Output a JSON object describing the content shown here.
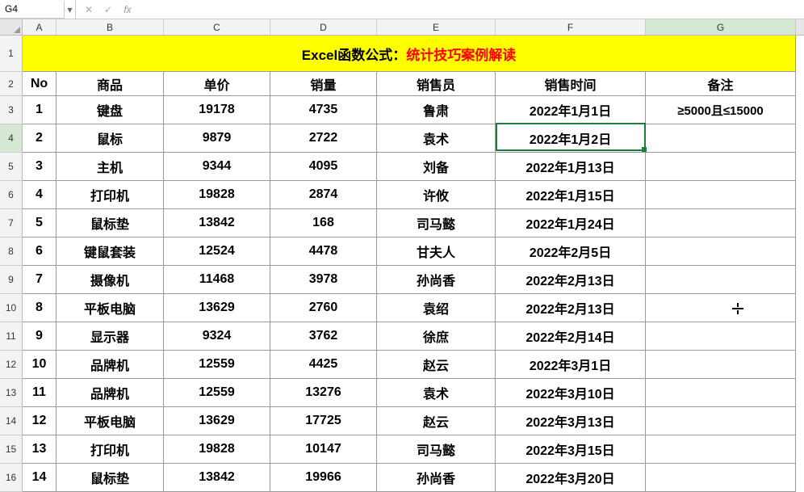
{
  "name_box": "G4",
  "formula": "",
  "col_labels": [
    "A",
    "B",
    "C",
    "D",
    "E",
    "F",
    "G"
  ],
  "selected_col": 6,
  "selected_row": 4,
  "title": {
    "black": "Excel函数公式：",
    "red": "统计技巧案例解读"
  },
  "headers": [
    "No",
    "商品",
    "单价",
    "销量",
    "销售员",
    "销售时间",
    "备注"
  ],
  "remark_first": "≥5000且≤15000",
  "rows": [
    {
      "no": "1",
      "p": "键盘",
      "price": "19178",
      "qty": "4735",
      "sales": "鲁肃",
      "date": "2022年1月1日"
    },
    {
      "no": "2",
      "p": "鼠标",
      "price": "9879",
      "qty": "2722",
      "sales": "袁术",
      "date": "2022年1月2日"
    },
    {
      "no": "3",
      "p": "主机",
      "price": "9344",
      "qty": "4095",
      "sales": "刘备",
      "date": "2022年1月13日"
    },
    {
      "no": "4",
      "p": "打印机",
      "price": "19828",
      "qty": "2874",
      "sales": "许攸",
      "date": "2022年1月15日"
    },
    {
      "no": "5",
      "p": "鼠标垫",
      "price": "13842",
      "qty": "168",
      "sales": "司马懿",
      "date": "2022年1月24日"
    },
    {
      "no": "6",
      "p": "键鼠套装",
      "price": "12524",
      "qty": "4478",
      "sales": "甘夫人",
      "date": "2022年2月5日"
    },
    {
      "no": "7",
      "p": "摄像机",
      "price": "11468",
      "qty": "3978",
      "sales": "孙尚香",
      "date": "2022年2月13日"
    },
    {
      "no": "8",
      "p": "平板电脑",
      "price": "13629",
      "qty": "2760",
      "sales": "袁绍",
      "date": "2022年2月13日"
    },
    {
      "no": "9",
      "p": "显示器",
      "price": "9324",
      "qty": "3762",
      "sales": "徐庶",
      "date": "2022年2月14日"
    },
    {
      "no": "10",
      "p": "品牌机",
      "price": "12559",
      "qty": "4425",
      "sales": "赵云",
      "date": "2022年3月1日"
    },
    {
      "no": "11",
      "p": "品牌机",
      "price": "12559",
      "qty": "13276",
      "sales": "袁术",
      "date": "2022年3月10日"
    },
    {
      "no": "12",
      "p": "平板电脑",
      "price": "13629",
      "qty": "17725",
      "sales": "赵云",
      "date": "2022年3月13日"
    },
    {
      "no": "13",
      "p": "打印机",
      "price": "19828",
      "qty": "10147",
      "sales": "司马懿",
      "date": "2022年3月15日"
    },
    {
      "no": "14",
      "p": "鼠标垫",
      "price": "13842",
      "qty": "19966",
      "sales": "孙尚香",
      "date": "2022年3月20日"
    }
  ],
  "chart_data": {
    "type": "table",
    "title": "Excel函数公式：统计技巧案例解读",
    "columns": [
      "No",
      "商品",
      "单价",
      "销量",
      "销售员",
      "销售时间",
      "备注"
    ],
    "data": [
      [
        1,
        "键盘",
        19178,
        4735,
        "鲁肃",
        "2022-01-01",
        "≥5000且≤15000"
      ],
      [
        2,
        "鼠标",
        9879,
        2722,
        "袁术",
        "2022-01-02",
        ""
      ],
      [
        3,
        "主机",
        9344,
        4095,
        "刘备",
        "2022-01-13",
        ""
      ],
      [
        4,
        "打印机",
        19828,
        2874,
        "许攸",
        "2022-01-15",
        ""
      ],
      [
        5,
        "鼠标垫",
        13842,
        168,
        "司马懿",
        "2022-01-24",
        ""
      ],
      [
        6,
        "键鼠套装",
        12524,
        4478,
        "甘夫人",
        "2022-02-05",
        ""
      ],
      [
        7,
        "摄像机",
        11468,
        3978,
        "孙尚香",
        "2022-02-13",
        ""
      ],
      [
        8,
        "平板电脑",
        13629,
        2760,
        "袁绍",
        "2022-02-13",
        ""
      ],
      [
        9,
        "显示器",
        9324,
        3762,
        "徐庶",
        "2022-02-14",
        ""
      ],
      [
        10,
        "品牌机",
        12559,
        4425,
        "赵云",
        "2022-03-01",
        ""
      ],
      [
        11,
        "品牌机",
        12559,
        13276,
        "袁术",
        "2022-03-10",
        ""
      ],
      [
        12,
        "平板电脑",
        13629,
        17725,
        "赵云",
        "2022-03-13",
        ""
      ],
      [
        13,
        "打印机",
        19828,
        10147,
        "司马懿",
        "2022-03-15",
        ""
      ],
      [
        14,
        "鼠标垫",
        13842,
        19966,
        "孙尚香",
        "2022-03-20",
        ""
      ]
    ]
  }
}
